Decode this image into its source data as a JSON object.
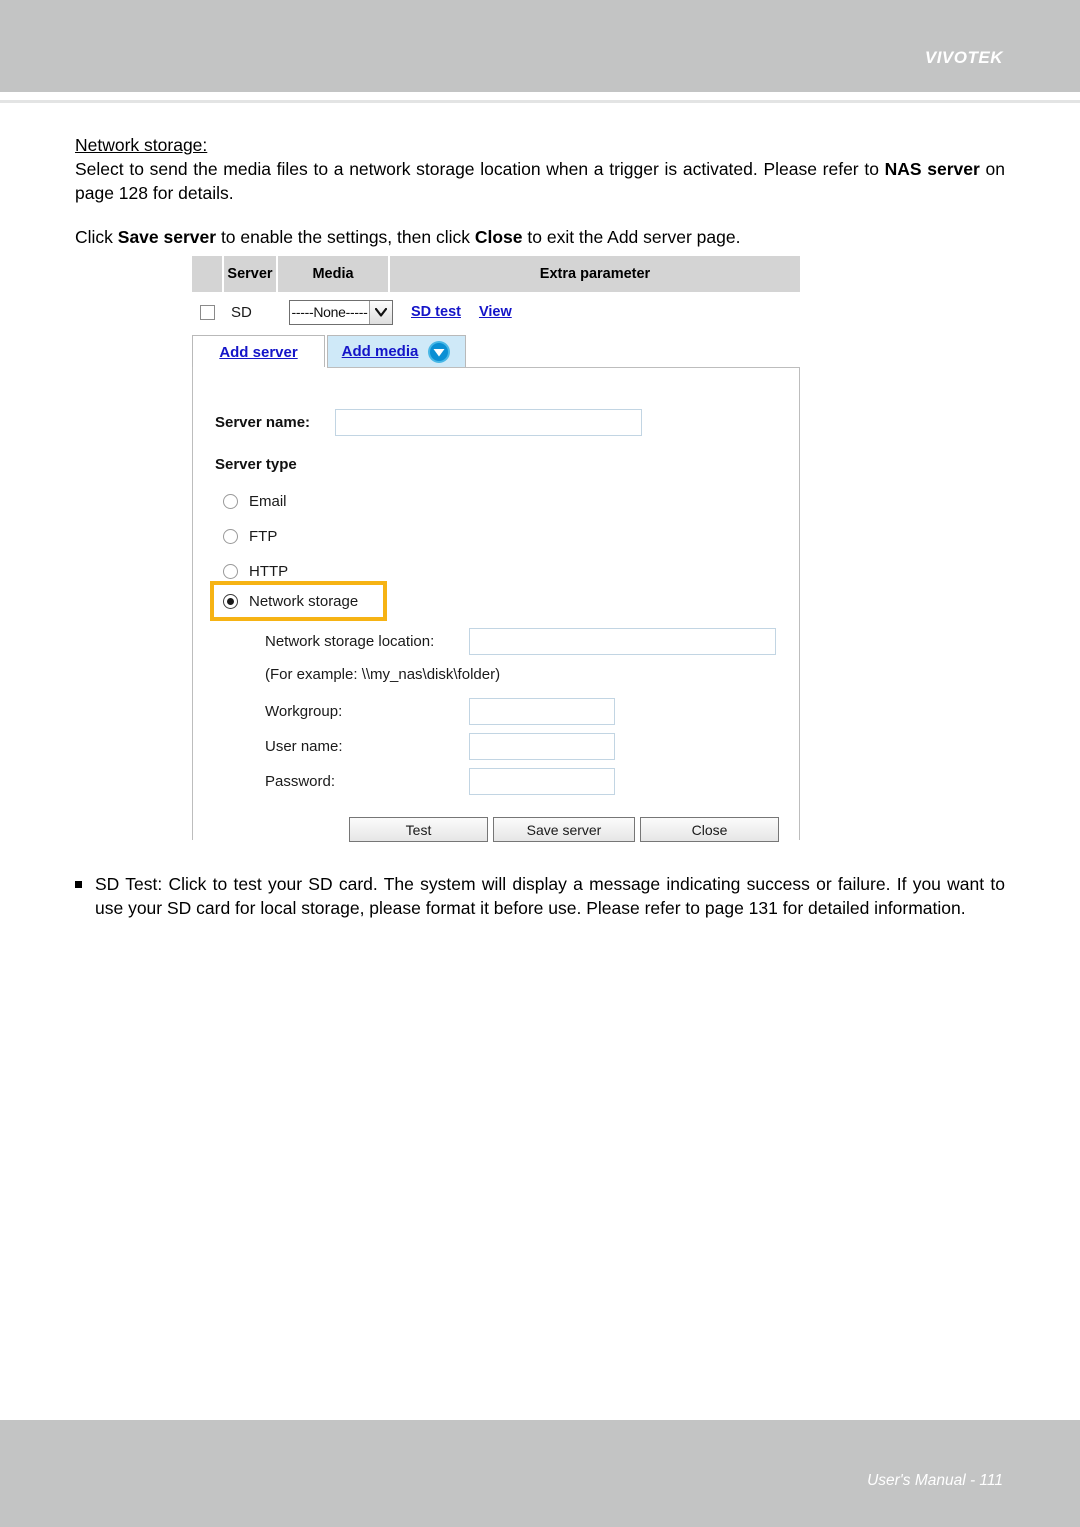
{
  "header": {
    "brand": "VIVOTEK"
  },
  "body_text": {
    "section_heading": "Network storage:",
    "paragraph_1_a": "Select to send the media files to a network storage location when a trigger is activated. Please refer to ",
    "paragraph_1_bold": "NAS server",
    "paragraph_1_b": " on page 128 for details.",
    "paragraph_2_a": "Click ",
    "paragraph_2_bold1": "Save server",
    "paragraph_2_b": " to enable the settings, then click ",
    "paragraph_2_bold2": "Close",
    "paragraph_2_c": " to exit the Add server page."
  },
  "table": {
    "columns": [
      "",
      "Server",
      "Media",
      "Extra parameter"
    ],
    "rows": [
      {
        "checked": false,
        "server": "SD",
        "media_selected": "-----None-----",
        "media_options": [
          "-----None-----"
        ],
        "links": [
          "SD test",
          "View"
        ]
      }
    ]
  },
  "tabs": [
    {
      "label": "Add server",
      "active": true,
      "icon": ""
    },
    {
      "label": "Add media",
      "active": false,
      "icon": "chevron-down-circle-icon"
    }
  ],
  "form": {
    "server_name_label": "Server name:",
    "server_name_value": "",
    "server_type_label": "Server type",
    "server_type_options": [
      {
        "label": "Email",
        "selected": false
      },
      {
        "label": "FTP",
        "selected": false
      },
      {
        "label": "HTTP",
        "selected": false
      },
      {
        "label": "Network storage",
        "selected": true
      }
    ],
    "network_storage": {
      "location_label": "Network storage location:",
      "location_value": "",
      "example_note": "(For example: \\\\my_nas\\disk\\folder)",
      "workgroup_label": "Workgroup:",
      "workgroup_value": "",
      "username_label": "User name:",
      "username_value": "",
      "password_label": "Password:",
      "password_value": ""
    },
    "buttons": [
      {
        "label": "Test"
      },
      {
        "label": "Save server"
      },
      {
        "label": "Close"
      }
    ]
  },
  "bullet": {
    "text": "SD Test: Click to test your SD card. The system will display a message indicating success or failure. If you want to use your SD card for local storage, please format it before use. Please refer to page 131 for detailed information."
  },
  "footer": {
    "text": "User's Manual - 111"
  },
  "colors": {
    "header_band": "#c3c4c4",
    "table_header": "#d4d4d4",
    "link_blue": "#1414c8",
    "tab_active_bg": "#ffffff",
    "tab_inactive_bg": "#cfe9f8",
    "highlight_orange": "#f6b314",
    "icon_blue": "#1b9bd8"
  }
}
